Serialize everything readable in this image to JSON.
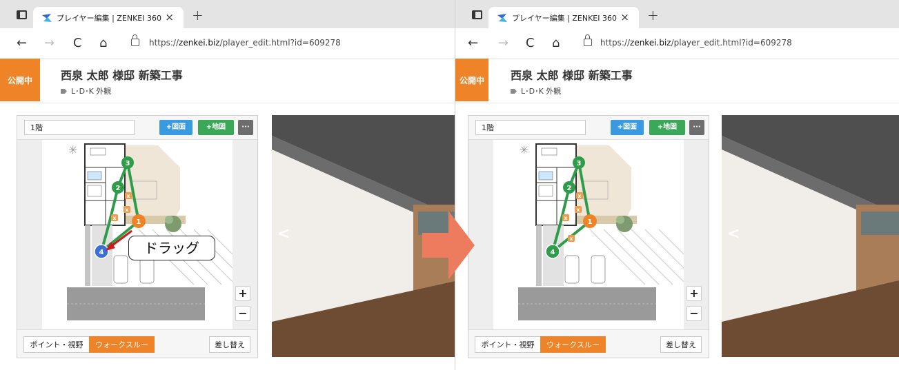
{
  "browser": {
    "tab_title": "プレイヤー編集 | ZENKEI 360",
    "tab_close": "×",
    "new_tab": "+",
    "back": "←",
    "forward": "→",
    "reload": "C",
    "home": "⌂",
    "url_prefix": "https://",
    "url_host": "zenkei.biz",
    "url_path": "/player_edit.html?id=609278"
  },
  "header": {
    "status_badge": "公開中",
    "project_title": "西泉 太郎 様邸 新築工事",
    "tag": "L･D･K 外観",
    "accent_color": "#ee8427"
  },
  "map": {
    "floor_value": "1階",
    "add_drawing": "+図面",
    "add_map": "+地図",
    "more": "···",
    "zoom_in": "+",
    "zoom_out": "−",
    "mode_point": "ポイント・視野",
    "mode_walkthrough": "ウォークスルー",
    "replace": "差し替え"
  },
  "viewer": {
    "prev": "<"
  },
  "before": {
    "points": [
      {
        "label": "1",
        "color": "orange"
      },
      {
        "label": "2",
        "color": "green"
      },
      {
        "label": "3",
        "color": "green"
      },
      {
        "label": "4",
        "color": "blue"
      }
    ],
    "delete_markers": "x"
  },
  "after": {
    "points": [
      {
        "label": "1",
        "color": "orange"
      },
      {
        "label": "2",
        "color": "green"
      },
      {
        "label": "3",
        "color": "green"
      },
      {
        "label": "4",
        "color": "green"
      }
    ],
    "delete_markers": "x"
  },
  "annotation": {
    "callout_text": "ドラッグ",
    "drag_arrow_color": "#cc1b1b",
    "transition_arrow_color": "#ec7c5d"
  }
}
